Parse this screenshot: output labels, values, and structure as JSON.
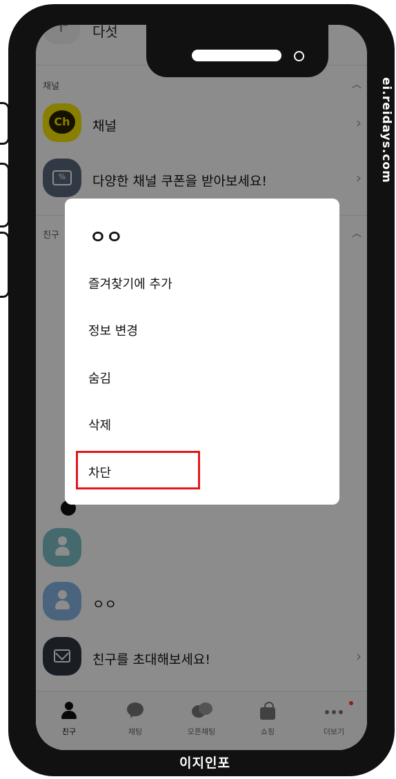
{
  "watermark": "ei.reidays.com",
  "caption": "이지인포",
  "top_row": {
    "label": "다섯"
  },
  "channel_section": {
    "title": "채널",
    "items": [
      {
        "label": "채널",
        "logo_text": "Ch",
        "avatar_color": "#f7e600"
      },
      {
        "label": "다양한 채널 쿠폰을 받아보세요!",
        "avatar_color": "#5a6b7d"
      }
    ]
  },
  "friends_section": {
    "title": "친구"
  },
  "friend_rows": [
    {
      "label": "",
      "avatar_color": "#7fc1c9"
    },
    {
      "label": "ㅇㅇ",
      "avatar_color": "#89b7e6"
    },
    {
      "label": "친구를 초대해보세요!",
      "avatar_color": "#2f3642"
    }
  ],
  "dialog": {
    "title": "ㅇㅇ",
    "items": [
      "즐겨찾기에 추가",
      "정보 변경",
      "숨김",
      "삭제",
      "차단"
    ],
    "highlighted_item": "차단",
    "highlight_color": "#e3161b"
  },
  "tabs": [
    {
      "label": "친구",
      "icon": "person-icon",
      "active": true
    },
    {
      "label": "채팅",
      "icon": "chat-icon"
    },
    {
      "label": "오픈채팅",
      "icon": "open-chat-icon"
    },
    {
      "label": "쇼핑",
      "icon": "shopping-bag-icon"
    },
    {
      "label": "더보기",
      "icon": "more-icon",
      "badge_color": "#ff3b30"
    }
  ]
}
